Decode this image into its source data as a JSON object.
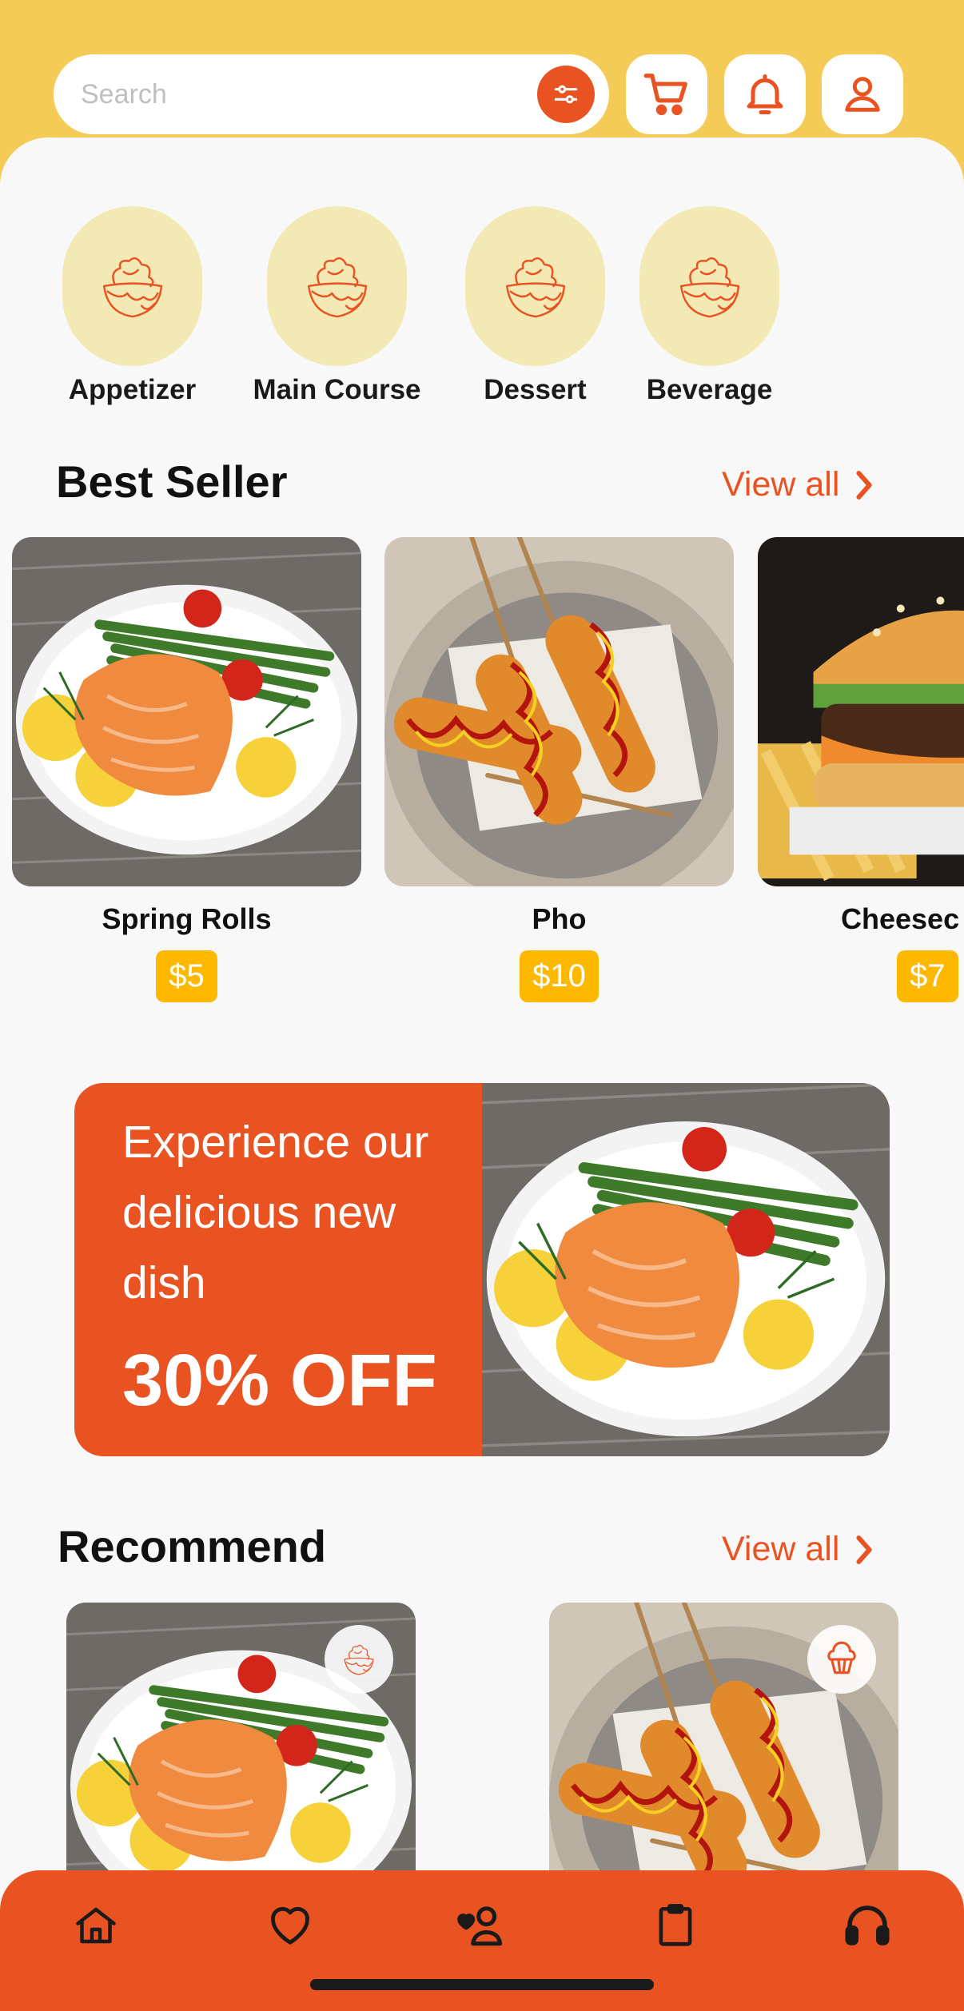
{
  "search": {
    "placeholder": "Search"
  },
  "icons": {
    "filter": "filter-icon",
    "cart": "cart-icon",
    "notifications": "bell-icon",
    "profile": "user-icon"
  },
  "categories": [
    {
      "label": "Appetizer",
      "icon": "snacks-icon"
    },
    {
      "label": "Main Course",
      "icon": "snacks-icon"
    },
    {
      "label": "Dessert",
      "icon": "snacks-icon"
    },
    {
      "label": "Beverage",
      "icon": "snacks-icon"
    }
  ],
  "best_seller": {
    "title": "Best Seller",
    "view_all": "View all",
    "items": [
      {
        "name": "Spring Rolls",
        "price": "$5"
      },
      {
        "name": "Pho",
        "price": "$10"
      },
      {
        "name": "Cheesec",
        "price": "$7"
      }
    ]
  },
  "promo": {
    "text": "Experience our delicious new dish",
    "discount": "30% OFF"
  },
  "recommend": {
    "title": "Recommend",
    "view_all": "View all"
  },
  "bottom_nav": [
    {
      "name": "home",
      "icon": "home-icon"
    },
    {
      "name": "favorites",
      "icon": "heart-icon"
    },
    {
      "name": "customers",
      "icon": "user-heart-icon"
    },
    {
      "name": "orders",
      "icon": "clipboard-icon"
    },
    {
      "name": "support",
      "icon": "headset-icon"
    }
  ],
  "colors": {
    "primary": "#E95322",
    "header": "#F5CB58",
    "price": "#FFB800",
    "category_bg": "#F3E9B5",
    "background": "#F8F8F8"
  }
}
